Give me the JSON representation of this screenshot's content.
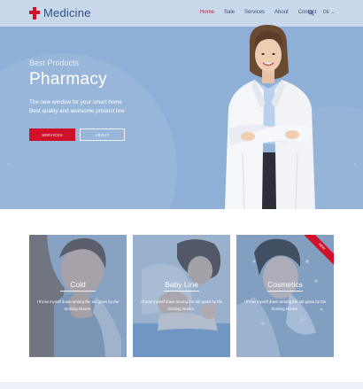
{
  "header": {
    "brand": "Medicine",
    "nav": [
      "Home",
      "Sale",
      "Services",
      "About",
      "Contact"
    ],
    "active_nav": "Home",
    "language": "DE"
  },
  "hero": {
    "kicker": "Best Products",
    "title": "Pharmacy",
    "subtitle_line1": "The new window for your smart home",
    "subtitle_line2": "Best quality and awesome product line",
    "primary_button": "SERVICES",
    "secondary_button": "ABOUT"
  },
  "cards": [
    {
      "title": "Cold",
      "text": "I throw myself down among the tall grass by the trickling stream.",
      "ribbon": ""
    },
    {
      "title": "Baby Line",
      "text": "I throw myself down among the tall grass by the trickling stream.",
      "ribbon": ""
    },
    {
      "title": "Cosmetics",
      "text": "I throw myself down among the tall grass by the trickling stream.",
      "ribbon": "NEW"
    }
  ],
  "colors": {
    "accent": "#d0112a",
    "hero_bg": "#8fb0d6",
    "brand_text": "#2b4f86"
  },
  "icons": [
    "cross-logo-icon",
    "search-icon",
    "chevron-down-icon"
  ]
}
